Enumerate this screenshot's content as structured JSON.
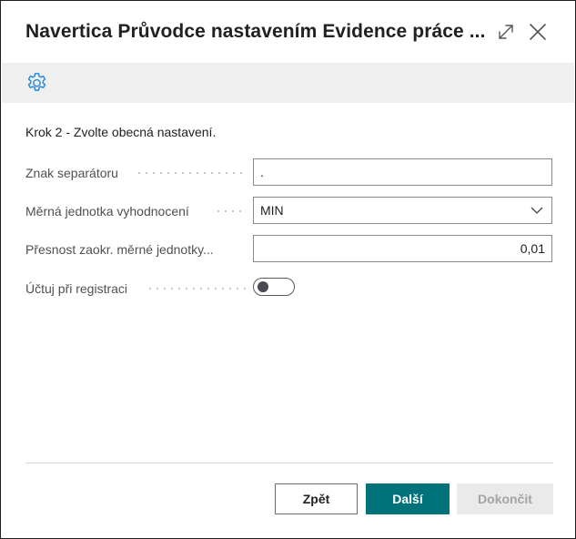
{
  "dialog": {
    "title": "Navertica Průvodce nastavením Evidence práce ...",
    "step_text": "Krok 2 - Zvolte obecná nastavení."
  },
  "fields": {
    "separator": {
      "label": "Znak separátoru",
      "value": "."
    },
    "unit": {
      "label": "Měrná jednotka vyhodnocení",
      "value": "MIN"
    },
    "precision": {
      "label": "Přesnost zaokr. měrné jednotky...",
      "value": "0,01"
    },
    "post_on_register": {
      "label": "Účtuj při registraci",
      "checked": false
    }
  },
  "buttons": {
    "back": "Zpět",
    "next": "Další",
    "finish": "Dokončit"
  },
  "colors": {
    "accent": "#00737a",
    "gear": "#2b88d8",
    "toolbar_bg": "#efefef",
    "disabled_bg": "#eaeaea"
  },
  "icons": [
    "expand-icon",
    "close-icon",
    "gear-icon",
    "chevron-down-icon"
  ]
}
